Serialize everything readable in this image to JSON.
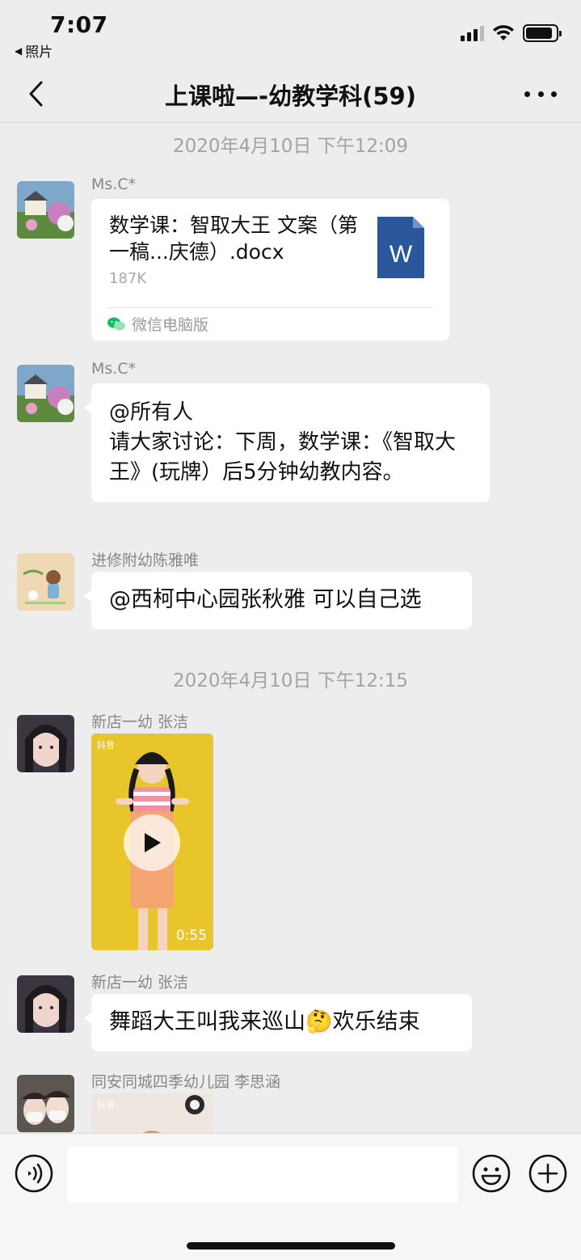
{
  "status_bar": {
    "time": "7:07",
    "back_app": "照片",
    "battery_level": 0.9
  },
  "nav": {
    "title": "上课啦—-幼教学科(59)"
  },
  "chat": {
    "timestamps": [
      "2020年4月10日 下午12:09",
      "2020年4月10日 下午12:15"
    ],
    "messages": [
      {
        "sender": "Ms.C*",
        "type": "file",
        "file_name": "数学课：智取大王 文案（第一稿...庆德）.docx",
        "file_size": "187K",
        "file_icon_letter": "W",
        "source": "微信电脑版"
      },
      {
        "sender": "Ms.C*",
        "type": "text",
        "text": "@所有人\n请大家讨论：下周，数学课：《智取大王》(玩牌）后5分钟幼教内容。"
      },
      {
        "sender": "进修附幼陈雅唯",
        "type": "text",
        "text": "@西柯中心园张秋雅 可以自己选"
      },
      {
        "sender": "新店一幼 张洁",
        "type": "video",
        "duration": "0:55",
        "app_label": "抖音"
      },
      {
        "sender": "新店一幼 张洁",
        "type": "text",
        "text": "舞蹈大王叫我来巡山🤔欢乐结束"
      },
      {
        "sender": "同安同城四季幼儿园 李思涵",
        "type": "video",
        "app_label": "抖音"
      }
    ]
  },
  "input_bar": {
    "voice_icon": "voice-icon",
    "emoji_icon": "emoji-icon",
    "plus_icon": "plus-icon"
  },
  "colors": {
    "background": "#ededed",
    "bubble": "#ffffff",
    "word_blue": "#2b579a",
    "wechat_green": "#07c160"
  }
}
